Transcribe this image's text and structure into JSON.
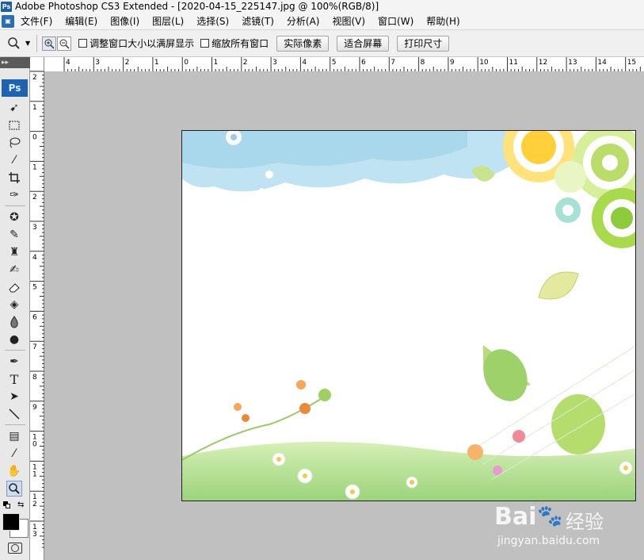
{
  "window": {
    "title": "Adobe Photoshop CS3 Extended - [2020-04-15_225147.jpg @ 100%(RGB/8)]",
    "app_badge": "Ps"
  },
  "menu": {
    "items": [
      "文件(F)",
      "编辑(E)",
      "图像(I)",
      "图层(L)",
      "选择(S)",
      "滤镜(T)",
      "分析(A)",
      "视图(V)",
      "窗口(W)",
      "帮助(H)"
    ]
  },
  "options": {
    "checkbox_resize": "调整窗口大小以满屏显示",
    "checkbox_zoom_all": "缩放所有窗口",
    "btn_actual": "实际像素",
    "btn_fit": "适合屏幕",
    "btn_print": "打印尺寸"
  },
  "toolbox": {
    "logo": "Ps",
    "collapse": "▸▸"
  },
  "rulers": {
    "h_labels": [
      "4",
      "3",
      "2",
      "1",
      "0",
      "1",
      "2",
      "3",
      "4",
      "5",
      "6",
      "7",
      "8",
      "9",
      "10",
      "11",
      "12",
      "13",
      "14",
      "15"
    ],
    "v_labels": [
      "2",
      "1",
      "0",
      "1",
      "2",
      "3",
      "4",
      "5",
      "6",
      "7",
      "8",
      "9",
      "10",
      "11",
      "12",
      "13"
    ]
  },
  "watermark": {
    "text": "Bai",
    "brand": "经验",
    "url": "jingyan.baidu.com"
  },
  "colors": {
    "ps_blue": "#1e62b0",
    "canvas_bg": "#c0c0c0"
  }
}
